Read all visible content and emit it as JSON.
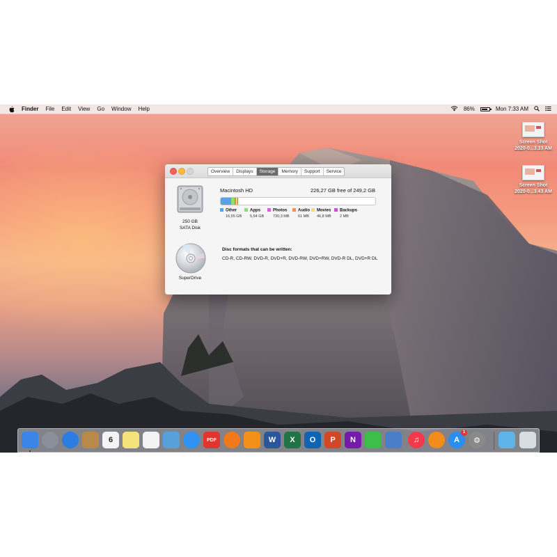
{
  "menubar": {
    "app_name": "Finder",
    "menus": [
      "File",
      "Edit",
      "View",
      "Go",
      "Window",
      "Help"
    ],
    "battery_percent": "86%",
    "battery_level": 0.86,
    "clock": "Mon 7:33 AM"
  },
  "desktop": {
    "files": [
      {
        "line1": "Screen Shot",
        "line2": "2020-0...3.33 AM"
      },
      {
        "line1": "Screen Shot",
        "line2": "2020-0...3.43 AM"
      }
    ]
  },
  "window": {
    "tabs": [
      "Overview",
      "Displays",
      "Storage",
      "Memory",
      "Support",
      "Service"
    ],
    "active_tab": "Storage",
    "disk": {
      "capacity": "250 GB",
      "type": "SATA Disk",
      "volume_name": "Macintosh HD",
      "free_text": "226,27 GB free of 249,2 GB"
    },
    "storage": [
      {
        "name": "Other",
        "size": "16,55 GB",
        "color": "#5aa2e8",
        "fraction": 0.0664
      },
      {
        "name": "Apps",
        "size": "5,54 GB",
        "color": "#8ee06a",
        "fraction": 0.0222
      },
      {
        "name": "Photos",
        "size": "730,3 MB",
        "color": "#e05ae0",
        "fraction": 0.0029
      },
      {
        "name": "Audio",
        "size": "61 MB",
        "color": "#f0905a",
        "fraction": 0.0003
      },
      {
        "name": "Movies",
        "size": "46,8 MB",
        "color": "#f6e05a",
        "fraction": 0.0002
      },
      {
        "name": "Backups",
        "size": "2 MB",
        "color": "#d04fd0",
        "fraction": 0.0001
      }
    ],
    "superdrive_label": "SuperDrive",
    "disc_formats_header": "Disc formats that can be written:",
    "disc_formats": "CD-R, CD-RW, DVD-R, DVD+R, DVD-RW, DVD+RW, DVD-R DL, DVD+R DL"
  },
  "dock": {
    "apps": [
      {
        "name": "finder-icon",
        "glyph": "",
        "color": "#3a86e8"
      },
      {
        "name": "launchpad-icon",
        "glyph": "",
        "color": "#8a8f9a"
      },
      {
        "name": "safari-icon",
        "glyph": "",
        "color": "#2a7de1"
      },
      {
        "name": "contacts-icon",
        "glyph": "",
        "color": "#b88a4a"
      },
      {
        "name": "calendar-icon",
        "glyph": "6",
        "color": "#f4f4f4"
      },
      {
        "name": "notes-icon",
        "glyph": "",
        "color": "#f5e27a"
      },
      {
        "name": "reminders-icon",
        "glyph": "",
        "color": "#f4f4f4"
      },
      {
        "name": "preview-icon",
        "glyph": "",
        "color": "#5aa0d8"
      },
      {
        "name": "messages-icon",
        "glyph": "",
        "color": "#2f93f5"
      },
      {
        "name": "pdf-expert-icon",
        "glyph": "PDF",
        "color": "#e0342f"
      },
      {
        "name": "firefox-icon",
        "glyph": "",
        "color": "#f07a1a"
      },
      {
        "name": "vlc-icon",
        "glyph": "",
        "color": "#f39019"
      },
      {
        "name": "word-icon",
        "glyph": "W",
        "color": "#2b579a"
      },
      {
        "name": "excel-icon",
        "glyph": "X",
        "color": "#217346"
      },
      {
        "name": "outlook-icon",
        "glyph": "O",
        "color": "#0f64b5"
      },
      {
        "name": "powerpoint-icon",
        "glyph": "P",
        "color": "#d24726"
      },
      {
        "name": "onenote-icon",
        "glyph": "N",
        "color": "#7719aa"
      },
      {
        "name": "facetime-icon",
        "glyph": "",
        "color": "#3bbf4a"
      },
      {
        "name": "mail-icon",
        "glyph": "",
        "color": "#4a7fc8"
      },
      {
        "name": "music-icon",
        "glyph": "♫",
        "color": "#f33a4a"
      },
      {
        "name": "books-icon",
        "glyph": "",
        "color": "#f28c1a"
      },
      {
        "name": "app-store-icon",
        "glyph": "A",
        "color": "#2a8ef0",
        "badge": "1"
      },
      {
        "name": "system-preferences-icon",
        "glyph": "⚙",
        "color": "#8a8a8a"
      },
      {
        "name": "downloads-folder-icon",
        "glyph": "",
        "color": "#5fb5ea"
      },
      {
        "name": "trash-icon",
        "glyph": "",
        "color": "#d8dde2"
      }
    ]
  }
}
